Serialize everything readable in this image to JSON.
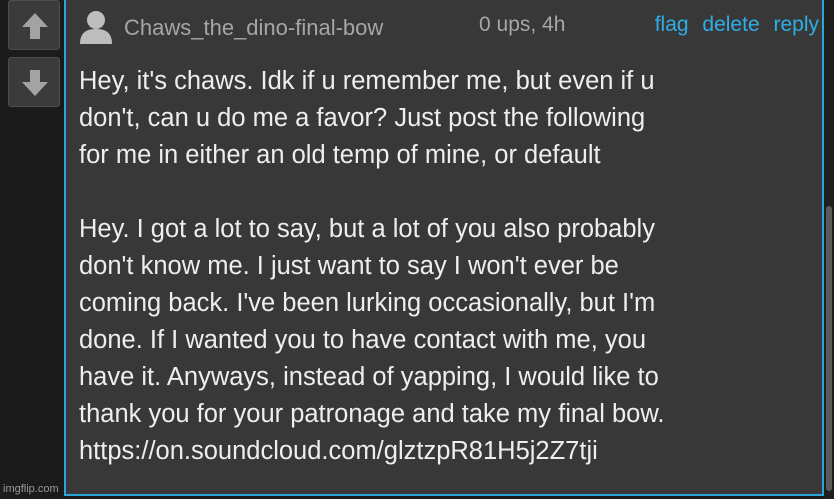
{
  "vote": {
    "up_icon": "arrow-up-icon",
    "down_icon": "arrow-down-icon"
  },
  "comment": {
    "avatar_icon": "user-avatar-icon",
    "username": "Chaws_the_dino-final-bow",
    "meta": "0 ups, 4h",
    "actions": {
      "flag": "flag",
      "delete": "delete",
      "reply": "reply"
    },
    "body": {
      "line1": "Hey, it's chaws. Idk if u remember me, but even if u",
      "line2": "don't, can u do me a favor? Just post the following",
      "line3": "for me in either an old temp of mine, or default",
      "line4": "Hey. I got a lot to say, but a lot of you also probably",
      "line5": "don't know me. I just want to say I won't ever be",
      "line6": "coming back. I've been lurking occasionally, but I'm",
      "line7": "done. If I wanted you to have contact with me, you",
      "line8": "have it. Anyways, instead of yapping, I would like to",
      "line9": "thank you for your patronage and take my final bow.",
      "line10": "https://on.soundcloud.com/glztzpR81H5j2Z7tji"
    }
  },
  "watermark": "imgflip.com",
  "colors": {
    "accent": "#2aa7d6",
    "link": "#2eaee6",
    "background": "#383838"
  }
}
